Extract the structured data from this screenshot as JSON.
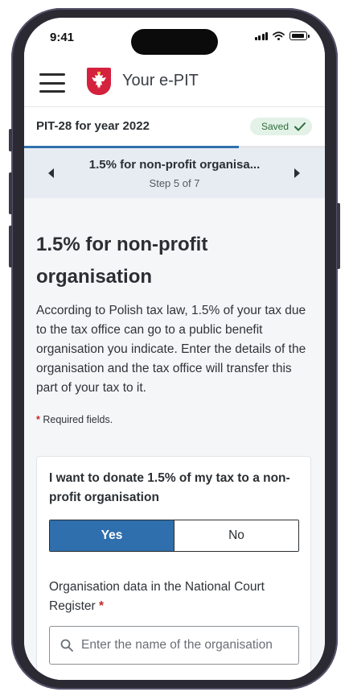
{
  "status_bar": {
    "time": "9:41"
  },
  "app": {
    "title": "Your e-PIT",
    "logo_icon": "polish-eagle-icon",
    "menu_icon": "hamburger-icon"
  },
  "form": {
    "title": "PIT-28 for year 2022",
    "saved_label": "Saved",
    "saved_icon": "checkmark-icon"
  },
  "progress": {
    "current_step": 5,
    "total_steps": 7,
    "fraction": 0.714
  },
  "step_nav": {
    "title": "1.5% for non-profit organisa...",
    "subtitle": "Step 5 of 7",
    "prev_icon": "chevron-left-icon",
    "next_icon": "chevron-right-icon"
  },
  "page": {
    "heading": "1.5% for non-profit organisation",
    "intro": "According to Polish tax law, 1.5% of your tax due to the tax office can go to a public benefit organisation you indicate. Enter the details of the organisation and the tax office will transfer this part of your tax to it.",
    "required_asterisk": "*",
    "required_note": "Required fields."
  },
  "donation": {
    "question": "I want to donate 1.5% of my tax to a non-profit organisation",
    "options": [
      "Yes",
      "No"
    ],
    "selected": "Yes"
  },
  "organisation": {
    "label": "Organisation data in the National Court Register",
    "required_asterisk": "*",
    "search_placeholder": "Enter the name of the organisation",
    "search_icon": "search-icon"
  },
  "colors": {
    "primary": "#2f6fad",
    "saved_bg": "#e3f2e7",
    "saved_text": "#2e6b3d",
    "logo_red": "#d4213d",
    "required": "#c62828"
  }
}
